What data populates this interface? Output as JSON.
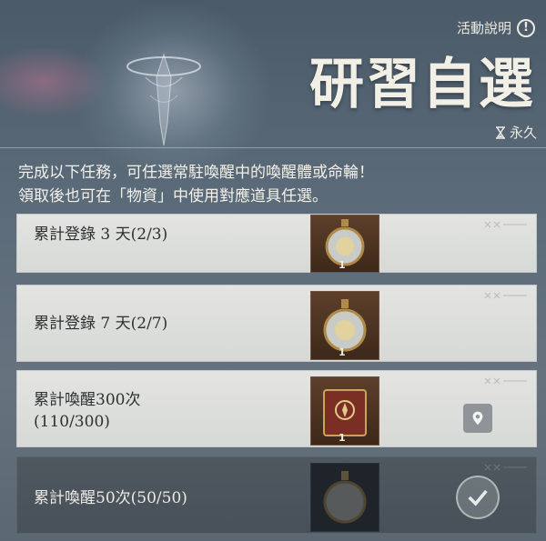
{
  "header": {
    "activity_info_label": "活動說明",
    "info_icon": "!",
    "title": "研習自選",
    "duration_label": "永久"
  },
  "description": {
    "line1": "完成以下任務，可任選常駐喚醒中的喚醒體或命輪！",
    "line2": "領取後也可在「物資」中使用對應道具任選。"
  },
  "tasks": [
    {
      "label": "累計登錄 3 天(2/3)",
      "reward_qty": "1",
      "reward_icon": "potion-bottle-icon",
      "state": "in-progress"
    },
    {
      "label": "累計登錄 7 天(2/7)",
      "reward_qty": "1",
      "reward_icon": "potion-bottle-icon",
      "state": "in-progress"
    },
    {
      "label_line1": "累計喚醒300次",
      "label_line2": "(110/300)",
      "reward_qty": "1",
      "reward_icon": "book-icon",
      "state": "in-progress",
      "action_icon": "locate-icon"
    },
    {
      "label": "累計喚醒50次(50/50)",
      "reward_qty": "1",
      "reward_icon": "potion-bottle-icon",
      "state": "claimed",
      "action_icon": "check-icon"
    }
  ],
  "colors": {
    "title": "#f2efe6",
    "card_bg": "#dcdedc",
    "card_claimed_bg": "#4f575f",
    "reward_bg": "#4a3221"
  }
}
